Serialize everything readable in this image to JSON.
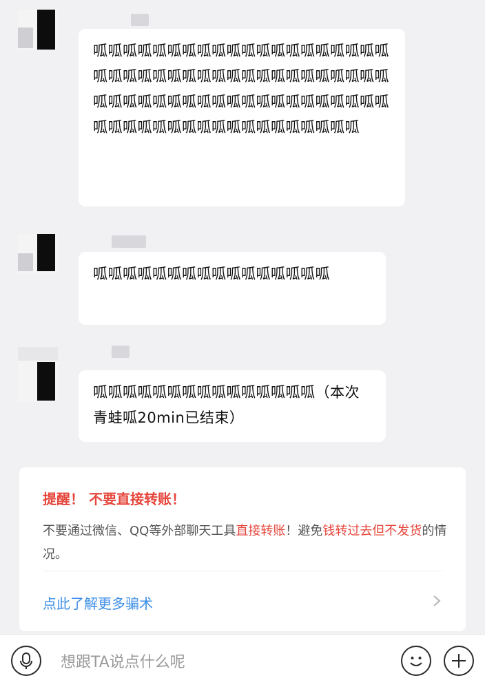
{
  "messages": [
    {
      "text": "呱呱呱呱呱呱呱呱呱呱呱呱呱呱呱呱呱呱呱呱呱呱呱呱呱呱呱呱呱呱呱呱呱呱呱呱呱呱呱呱呱呱呱呱呱呱呱呱呱呱呱呱呱呱呱呱呱呱呱呱呱呱呱呱呱呱呱呱呱呱呱呱呱呱呱呱呱呱"
    },
    {
      "text": "呱呱呱呱呱呱呱呱呱呱呱呱呱呱呱呱"
    },
    {
      "text": "呱呱呱呱呱呱呱呱呱呱呱呱呱呱呱（本次青蛙呱20min已结束）"
    }
  ],
  "warning": {
    "title": "提醒！ 不要直接转账！",
    "body_prefix": "不要通过微信、QQ等外部聊天工具",
    "body_red1": "直接转账",
    "body_mid": "！避免",
    "body_red2": "钱转过去但不发货",
    "body_suffix": "的情况。",
    "link": "点此了解更多骗术"
  },
  "input": {
    "placeholder": "想跟TA说点什么呢"
  },
  "icons": {
    "voice": "microphone-icon",
    "emoji": "smiley-icon",
    "more": "plus-icon",
    "chevron": "chevron-right-icon"
  },
  "colors": {
    "warning_red": "#e6453b",
    "link_blue": "#3d8ee8"
  }
}
